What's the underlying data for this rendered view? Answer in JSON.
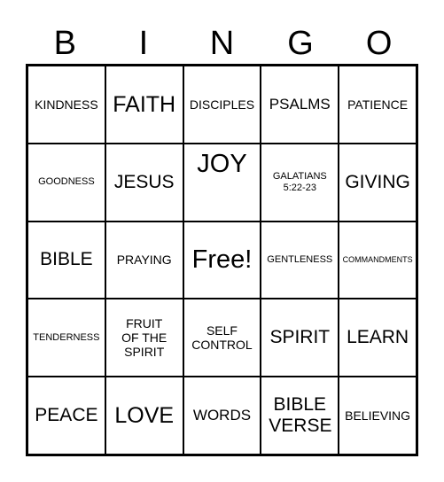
{
  "header": [
    "B",
    "I",
    "N",
    "G",
    "O"
  ],
  "cells": [
    {
      "text": "KINDNESS",
      "size": "s-m"
    },
    {
      "text": "FAITH",
      "size": "s-xxl"
    },
    {
      "text": "DISCIPLES",
      "size": "s-m"
    },
    {
      "text": "PSALMS",
      "size": "s-l"
    },
    {
      "text": "PATIENCE",
      "size": "s-m"
    },
    {
      "text": "GOODNESS",
      "size": "s-s"
    },
    {
      "text": "JESUS",
      "size": "s-xl"
    },
    {
      "text": "JOY",
      "size": "s-xxxl",
      "align": "top"
    },
    {
      "text": "GALATIANS 5:22-23",
      "size": "s-s"
    },
    {
      "text": "GIVING",
      "size": "s-xl"
    },
    {
      "text": "BIBLE",
      "size": "s-xl"
    },
    {
      "text": "PRAYING",
      "size": "s-m"
    },
    {
      "text": "Free!",
      "size": "s-xxxl"
    },
    {
      "text": "GENTLENESS",
      "size": "s-s"
    },
    {
      "text": "COMMANDMENTS",
      "size": "s-xs"
    },
    {
      "text": "TENDERNESS",
      "size": "s-s"
    },
    {
      "text": "FRUIT OF THE SPIRIT",
      "size": "s-m"
    },
    {
      "text": "SELF CONTROL",
      "size": "s-m"
    },
    {
      "text": "SPIRIT",
      "size": "s-xl"
    },
    {
      "text": "LEARN",
      "size": "s-xl"
    },
    {
      "text": "PEACE",
      "size": "s-xl"
    },
    {
      "text": "LOVE",
      "size": "s-xxl"
    },
    {
      "text": "WORDS",
      "size": "s-l"
    },
    {
      "text": "BIBLE VERSE",
      "size": "s-xl"
    },
    {
      "text": "BELIEVING",
      "size": "s-m"
    }
  ]
}
